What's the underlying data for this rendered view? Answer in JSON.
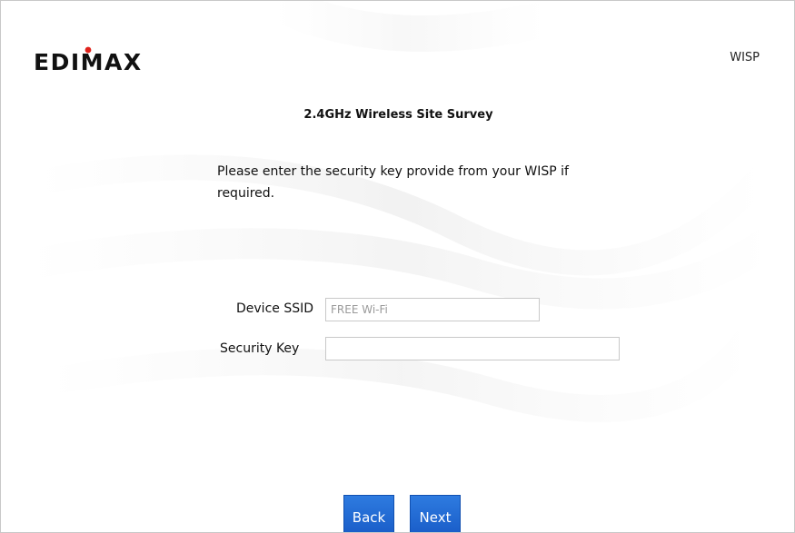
{
  "header": {
    "brand": "EDIMAX",
    "mode": "WISP"
  },
  "main": {
    "title": "2.4GHz Wireless Site Survey",
    "instruction": "Please enter the security key provide from your WISP if required.",
    "fields": {
      "ssid_label": "Device SSID",
      "ssid_value": "FREE Wi-Fi",
      "key_label": "Security Key",
      "key_value": ""
    }
  },
  "buttons": {
    "back": "Back",
    "next": "Next"
  },
  "colors": {
    "button_blue": "#1f66d1",
    "logo_black": "#111111",
    "logo_red_dot": "#e0221b"
  }
}
